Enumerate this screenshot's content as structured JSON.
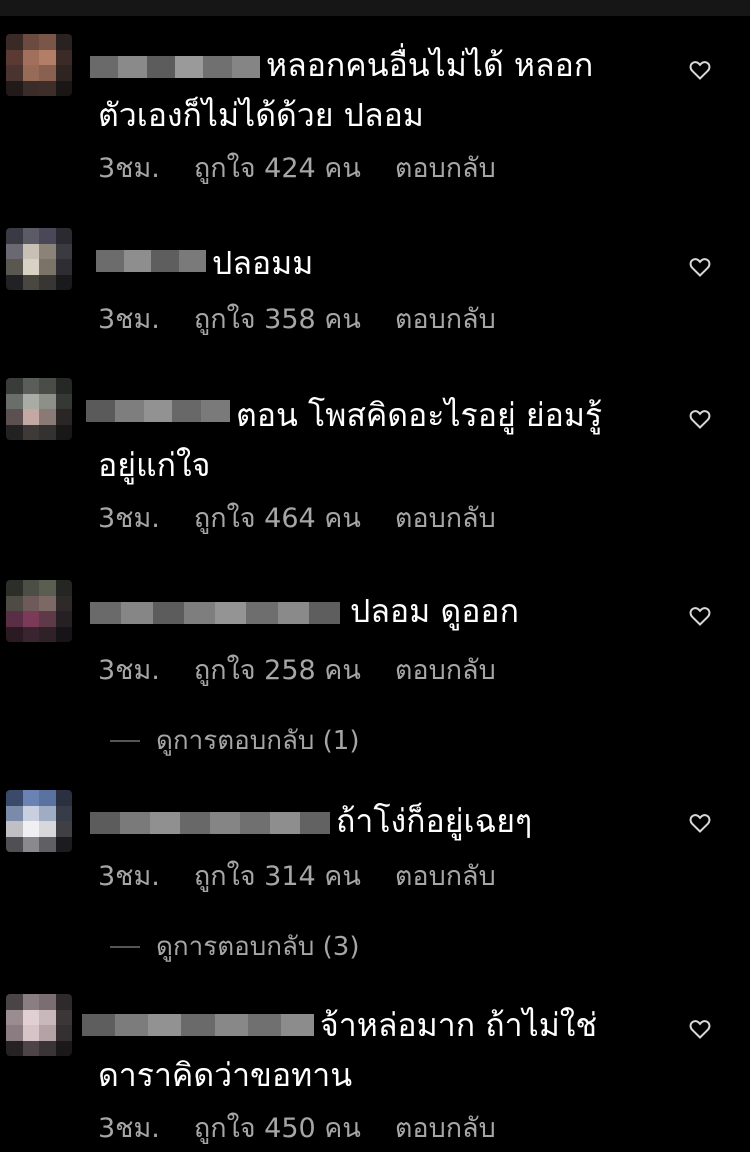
{
  "icons": {
    "like": "heart-outline-icon"
  },
  "comments": [
    {
      "text": "หลอกคนอื่นไม่ได้ หลอก\nตัวเองก็ไม่ได้ด้วย ปลอม",
      "time": "3ชม.",
      "likes": "ถูกใจ 424 คน",
      "reply": "ตอบกลับ"
    },
    {
      "text": "ปลอมม",
      "time": "3ชม.",
      "likes": "ถูกใจ 358 คน",
      "reply": "ตอบกลับ"
    },
    {
      "text": "ตอน โพสคิดอะไรอยู่ ย่อมรู้\nอยู่แก่ใจ",
      "time": "3ชม.",
      "likes": "ถูกใจ 464 คน",
      "reply": "ตอบกลับ"
    },
    {
      "text": "ปลอม ดูออก",
      "time": "3ชม.",
      "likes": "ถูกใจ 258 คน",
      "reply": "ตอบกลับ",
      "view_replies": "ดูการตอบกลับ (1)"
    },
    {
      "text": "ถ้าโง่ก็อยู่เฉยๆ",
      "time": "3ชม.",
      "likes": "ถูกใจ 314 คน",
      "reply": "ตอบกลับ",
      "view_replies": "ดูการตอบกลับ (3)"
    },
    {
      "text": "จ้าหล่อมาก ถ้าไม่ใช่\nดาราคิดว่าขอทาน",
      "time": "3ชม.",
      "likes": "ถูกใจ 450 คน",
      "reply": "ตอบกลับ"
    }
  ]
}
